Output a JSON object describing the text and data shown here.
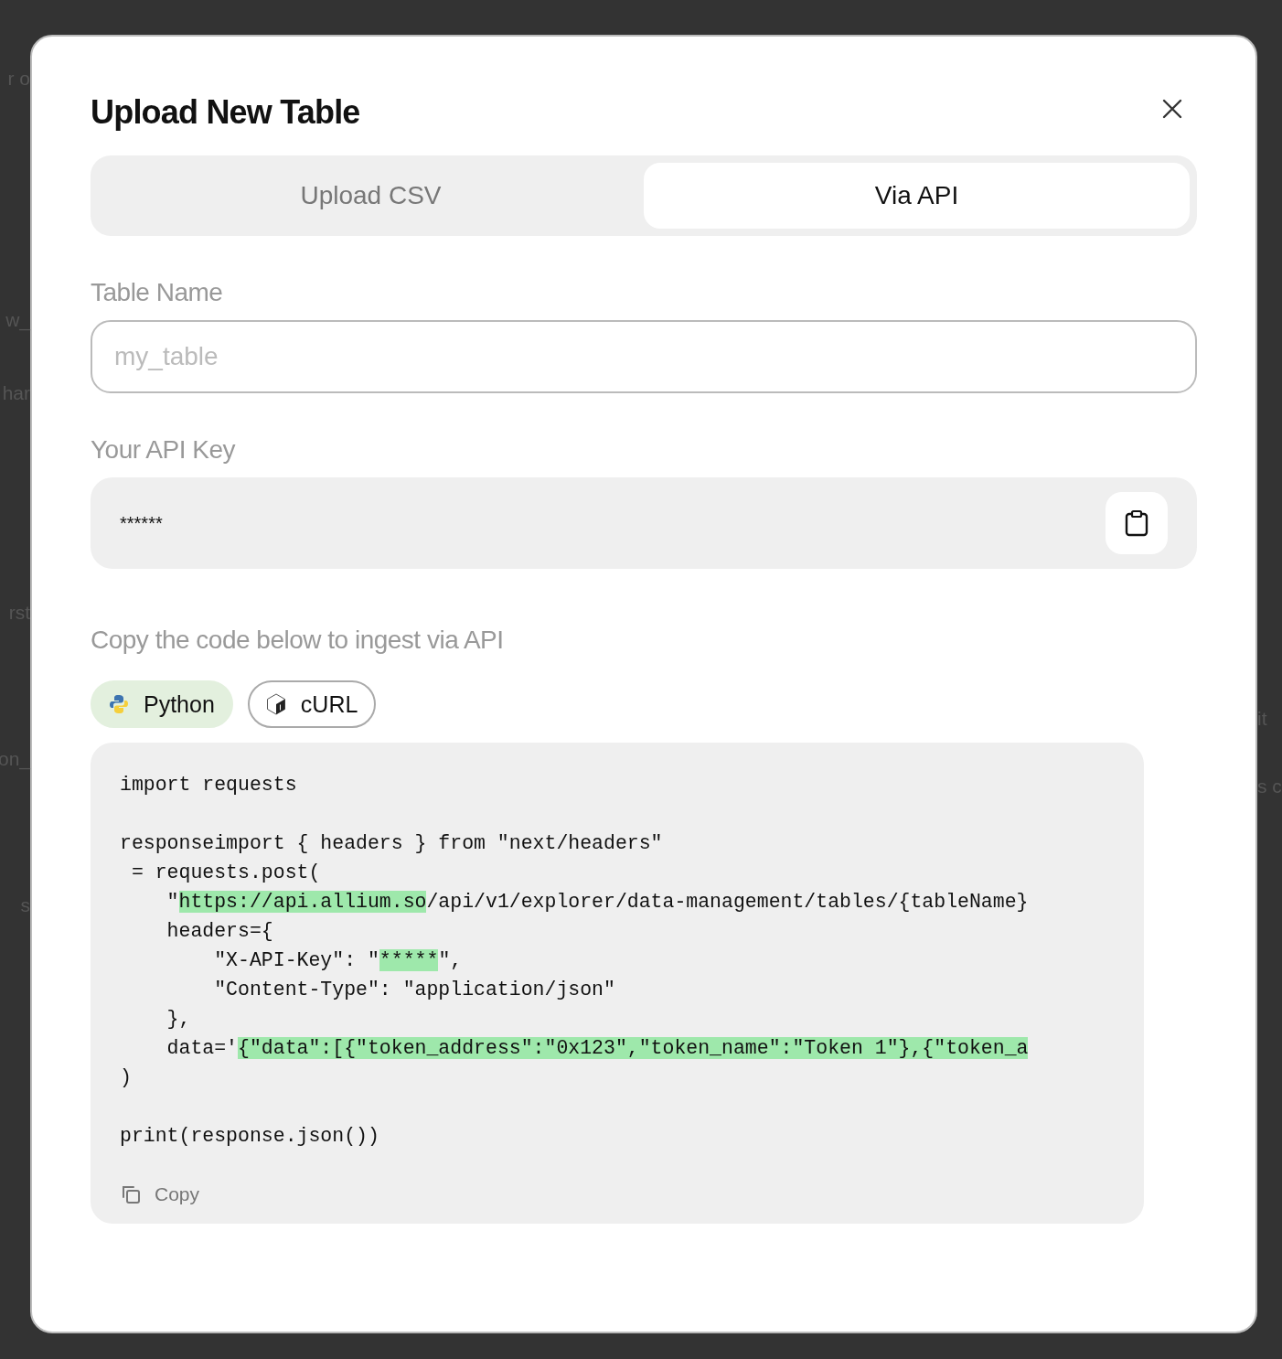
{
  "background_fragments": {
    "left": [
      "r o",
      "w_",
      "har",
      "rst",
      "on_",
      "s"
    ],
    "right": [
      "it",
      "s c"
    ]
  },
  "dialog": {
    "title": "Upload New Table",
    "tabs": [
      {
        "label": "Upload CSV",
        "selected": false
      },
      {
        "label": "Via API",
        "selected": true
      }
    ],
    "table_name": {
      "label": "Table Name",
      "placeholder": "my_table"
    },
    "api_key": {
      "label": "Your API Key",
      "value": "******"
    },
    "code_intro": "Copy the code below to ingest via API",
    "languages": [
      {
        "label": "Python",
        "kind": "python",
        "selected": true
      },
      {
        "label": "cURL",
        "kind": "curl",
        "selected": false
      }
    ],
    "code_lines": [
      {
        "kind": "text",
        "segments": [
          {
            "text": "import requests",
            "highlight": false
          }
        ]
      },
      {
        "kind": "blank"
      },
      {
        "kind": "text",
        "segments": [
          {
            "text": "responseimport { headers } from \"next/headers\"",
            "highlight": false
          }
        ]
      },
      {
        "kind": "text",
        "segments": [
          {
            "text": " = requests.post(",
            "highlight": false
          }
        ]
      },
      {
        "kind": "text",
        "segments": [
          {
            "text": "    \"",
            "highlight": false
          },
          {
            "text": "https://api.allium.so",
            "highlight": true
          },
          {
            "text": "/api/v1/explorer/data-management/tables/{tableName}",
            "highlight": false
          }
        ]
      },
      {
        "kind": "text",
        "segments": [
          {
            "text": "    headers={",
            "highlight": false
          }
        ]
      },
      {
        "kind": "text",
        "segments": [
          {
            "text": "        \"X-API-Key\": \"",
            "highlight": false
          },
          {
            "text": "*****",
            "highlight": true
          },
          {
            "text": "\",",
            "highlight": false
          }
        ]
      },
      {
        "kind": "text",
        "segments": [
          {
            "text": "        \"Content-Type\": \"application/json\"",
            "highlight": false
          }
        ]
      },
      {
        "kind": "text",
        "segments": [
          {
            "text": "    },",
            "highlight": false
          }
        ]
      },
      {
        "kind": "text",
        "segments": [
          {
            "text": "    data='",
            "highlight": false
          },
          {
            "text": "{\"data\":[{\"token_address\":\"0x123\",\"token_name\":\"Token 1\"},{\"token_a",
            "highlight": true
          }
        ]
      },
      {
        "kind": "text",
        "segments": [
          {
            "text": ")",
            "highlight": false
          }
        ]
      },
      {
        "kind": "blank"
      },
      {
        "kind": "text",
        "segments": [
          {
            "text": "print(response.json())",
            "highlight": false
          }
        ]
      }
    ],
    "copy_label": "Copy"
  }
}
